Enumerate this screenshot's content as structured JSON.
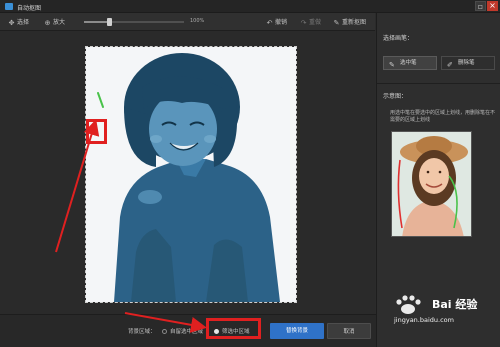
{
  "window": {
    "title": "自动抠图"
  },
  "toolbar": {
    "select_label": "选择",
    "zoom_in_label": "放大",
    "zoom_level": "100%",
    "zoom_fraction": 0.25,
    "undo_label": "撤销",
    "redo_label": "重做",
    "redraw_label": "重新抠图"
  },
  "panel": {
    "select_pen_title": "选择画笔：",
    "selected_pen_label": "选中笔",
    "delete_pen_label": "删除笔",
    "example_title": "示意图：",
    "instructions": "用选中笔在要选中的区域上划线，用删除笔在不需要的区域上划线"
  },
  "bottom": {
    "background_area_label": "背景区域：",
    "option_selected_area": "自留选中区域",
    "option_delete_area": "筛选中区域",
    "apply_button": "替换背景",
    "cancel_button": "取消"
  },
  "watermark": {
    "brand": "Bai 经验",
    "url": "jingyan.baidu.com"
  },
  "colors": {
    "accent": "#2f72c8",
    "highlight_box": "#e02020",
    "tint": "#2d6a92"
  }
}
